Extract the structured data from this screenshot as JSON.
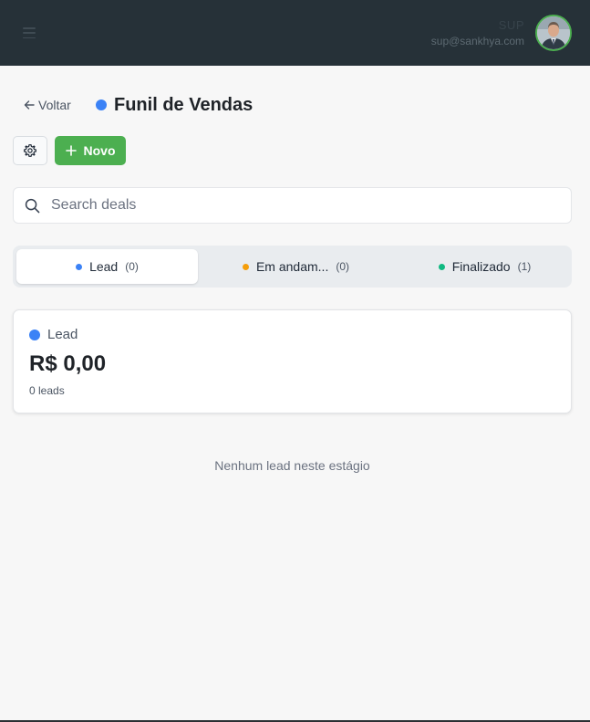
{
  "header": {
    "user_name": "SUP",
    "user_email": "sup@sankhya.com",
    "menu_icon": "hamburger-icon",
    "accent_color": "#4caf50",
    "background_color": "#263138"
  },
  "page": {
    "back_label": "Voltar",
    "back_icon": "arrow-left-icon",
    "title": "Funil de Vendas",
    "title_dot_color": "#3b82f6"
  },
  "toolbar": {
    "settings_icon": "gear-icon",
    "new_label": "Novo",
    "new_icon": "plus-icon",
    "new_button_color": "#4caf50"
  },
  "search": {
    "placeholder": "Search deals",
    "value": "",
    "icon": "search-icon"
  },
  "tabs": [
    {
      "label": "Lead",
      "count": "(0)",
      "color": "#3b82f6",
      "active": true
    },
    {
      "label": "Em andam...",
      "count": "(0)",
      "color": "#f59e0b",
      "active": false
    },
    {
      "label": "Finalizado",
      "count": "(1)",
      "color": "#10b981",
      "active": false
    }
  ],
  "stage": {
    "name": "Lead",
    "amount": "R$ 0,00",
    "count_label": "0 leads",
    "dot_color": "#3b82f6"
  },
  "empty_message": "Nenhum lead neste estágio"
}
